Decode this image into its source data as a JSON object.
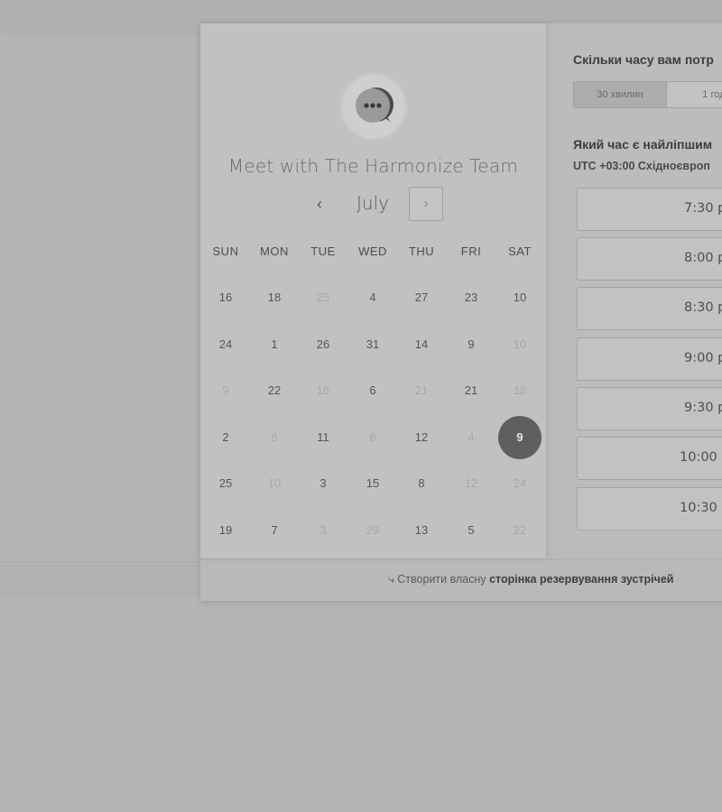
{
  "booking": {
    "org_title": "Meet with The Harmonize Team",
    "month": "July",
    "prev_label": "‹",
    "next_label": "›",
    "weekdays": [
      "SUN",
      "MON",
      "TUE",
      "WED",
      "THU",
      "FRI",
      "SAT"
    ],
    "weeks": [
      [
        "16",
        "18",
        "25",
        "4",
        "27",
        "23",
        "10"
      ],
      [
        "24",
        "1",
        "26",
        "31",
        "14",
        "9",
        "10"
      ],
      [
        "9",
        "22",
        "16",
        "6",
        "21",
        "21",
        "18"
      ],
      [
        "2",
        "8",
        "11",
        "8",
        "12",
        "4",
        "9"
      ],
      [
        "25",
        "10",
        "3",
        "15",
        "8",
        "12",
        "24"
      ],
      [
        "19",
        "7",
        "3",
        "29",
        "13",
        "5",
        "22"
      ]
    ],
    "muted_days": "marked in template",
    "selected_day": "9"
  },
  "right": {
    "duration_question": "Скільки часу вам потр",
    "durations": [
      "30 хвилин",
      "1 годи"
    ],
    "time_question": "Який час є найліпшим",
    "timezone": "UTC +03:00 Східноєвроп",
    "slots": [
      "7:30 р",
      "8:00 р",
      "8:30 р",
      "9:00 р",
      "9:30 р",
      "10:00",
      "10:30"
    ]
  },
  "footer": {
    "prefix": "Створити власну",
    "link": "сторінка резервування зустрічей"
  },
  "colors": {
    "selected_day_bg": "#5f5f5f",
    "panel_bg": "#c1c1c1"
  },
  "icons": {
    "avatar": "chat-bubble-icon",
    "prev": "chevron-left-icon",
    "next": "chevron-right-icon",
    "footer": "sparkle-arrow-icon"
  }
}
